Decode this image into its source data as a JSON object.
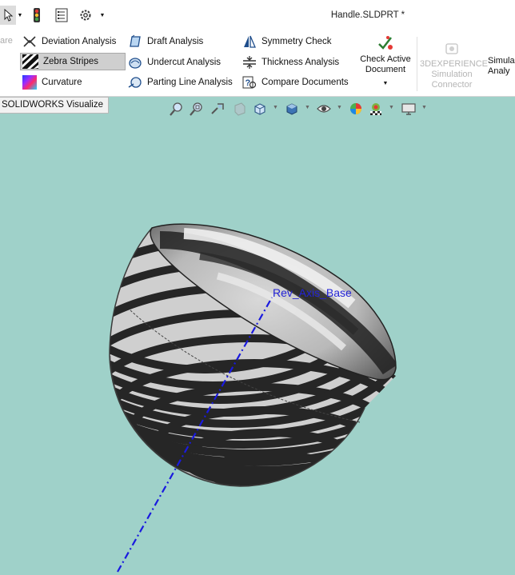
{
  "window": {
    "title": "Handle.SLDPRT *"
  },
  "quick_access": {
    "icons": [
      "select-arrow-icon",
      "dropdown-caret-icon",
      "traffic-light-icon",
      "file-properties-icon",
      "gear-icon",
      "dropdown-caret-icon"
    ]
  },
  "ribbon": {
    "cut_label": "are",
    "col1": [
      {
        "label": "Deviation Analysis",
        "icon": "deviation-analysis-icon"
      },
      {
        "label": "Zebra Stripes",
        "icon": "zebra-stripes-icon",
        "active": true
      },
      {
        "label": "Curvature",
        "icon": "curvature-icon"
      }
    ],
    "col2": [
      {
        "label": "Draft Analysis",
        "icon": "draft-analysis-icon"
      },
      {
        "label": "Undercut Analysis",
        "icon": "undercut-analysis-icon"
      },
      {
        "label": "Parting Line Analysis",
        "icon": "parting-line-analysis-icon"
      }
    ],
    "col3": [
      {
        "label": "Symmetry Check",
        "icon": "symmetry-check-icon"
      },
      {
        "label": "Thickness Analysis",
        "icon": "thickness-analysis-icon"
      },
      {
        "label": "Compare Documents",
        "icon": "compare-documents-icon"
      }
    ],
    "check_active": {
      "line1": "Check Active",
      "line2": "Document"
    },
    "simulation_connector": {
      "line1": "3DEXPERIENCE",
      "line2": "Simulation",
      "line3": "Connector"
    },
    "simulation_analysis": {
      "line1": "Simula",
      "line2": "Analy"
    }
  },
  "tab": {
    "label": "SOLIDWORKS Visualize"
  },
  "viewport": {
    "axis_label": "Rev_Axis_Base",
    "colors": {
      "background": "#9fd1c9",
      "axis": "#1a1adf",
      "stripe_dark": "#2a2a2a",
      "stripe_light": "#cfcfcf"
    }
  }
}
